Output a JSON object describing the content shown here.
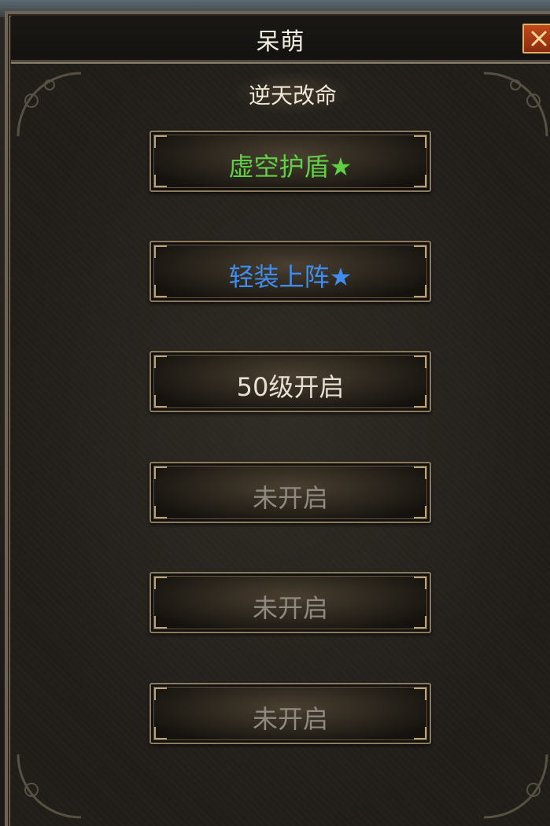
{
  "window": {
    "title": "呆萌",
    "close_icon": "close-x-icon"
  },
  "panel": {
    "subtitle": "逆天改命"
  },
  "skills": [
    {
      "label": "虚空护盾★",
      "color": "#5fd045"
    },
    {
      "label": "轻装上阵★",
      "color": "#3f8df0"
    },
    {
      "label": "50级开启",
      "color": "#e6dfd2"
    },
    {
      "label": "未开启",
      "color": "#8e8a82"
    },
    {
      "label": "未开启",
      "color": "#8e8a82"
    },
    {
      "label": "未开启",
      "color": "#8e8a82"
    }
  ],
  "colors": {
    "close_button": "#c0491b",
    "frame_gold": "#b9a27a"
  }
}
